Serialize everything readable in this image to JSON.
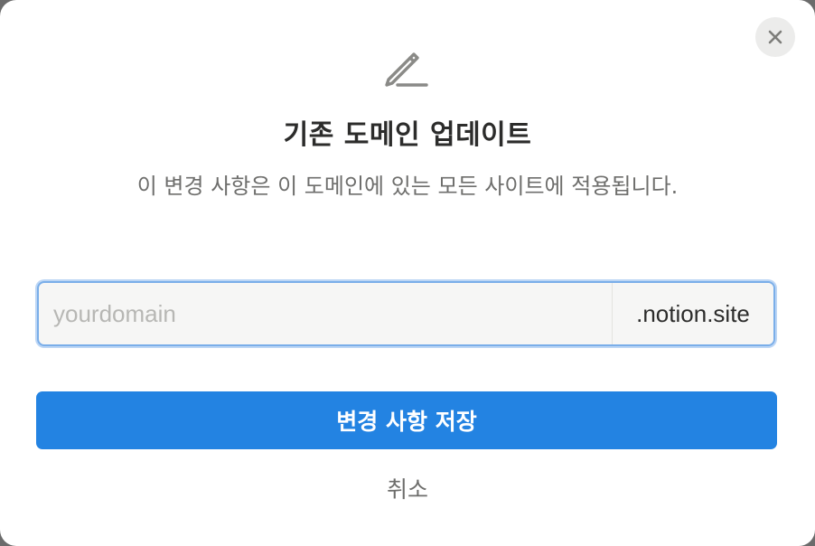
{
  "dialog": {
    "title": "기존 도메인 업데이트",
    "description": "이 변경 사항은 이 도메인에 있는 모든 사이트에 적용됩니다.",
    "header_icon": "pencil-icon",
    "close_icon": "close-icon"
  },
  "domain_field": {
    "placeholder": "yourdomain",
    "value": "",
    "suffix": ".notion.site"
  },
  "actions": {
    "save_label": "변경 사항 저장",
    "cancel_label": "취소"
  },
  "colors": {
    "primary": "#2383e2",
    "focus_border": "#7aaee9",
    "text_primary": "#2c2c2b",
    "text_secondary": "#6e6e6c"
  }
}
